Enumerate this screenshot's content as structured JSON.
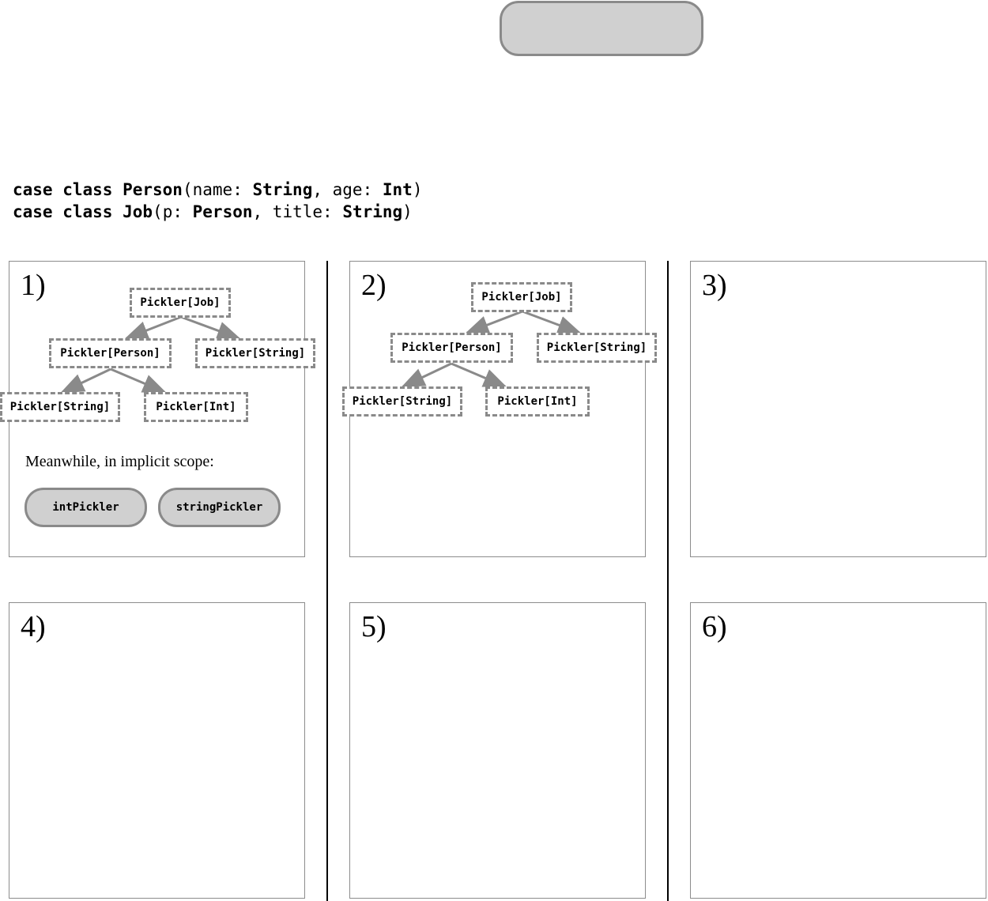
{
  "code": {
    "line1": {
      "kw": "case class",
      "name": "Person",
      "open": "(",
      "p1": "name",
      "c1": ": ",
      "t1": "String",
      "sep": ", ",
      "p2": "age",
      "c2": ": ",
      "t2": "Int",
      "close": ")"
    },
    "line2": {
      "kw": "case class",
      "name": "Job",
      "open": "(",
      "p1": "p",
      "c1": ": ",
      "t1": "Person",
      "sep": ", ",
      "p2": "title",
      "c2": ": ",
      "t2": "String",
      "close": ")"
    }
  },
  "panels": [
    {
      "label": "1)"
    },
    {
      "label": "2)"
    },
    {
      "label": "3)"
    },
    {
      "label": "4)"
    },
    {
      "label": "5)"
    },
    {
      "label": "6)"
    }
  ],
  "tree": {
    "root": "Pickler[Job]",
    "person": "Pickler[Person]",
    "string": "Pickler[String]",
    "person_string": "Pickler[String]",
    "person_int": "Pickler[Int]"
  },
  "scope": {
    "text": "Meanwhile, in implicit scope:",
    "pills": [
      "intPickler",
      "stringPickler"
    ]
  },
  "colors": {
    "node_border": "#8a8a8a",
    "pill_fill": "#d0d0d0",
    "edge": "#8a8a8a"
  }
}
